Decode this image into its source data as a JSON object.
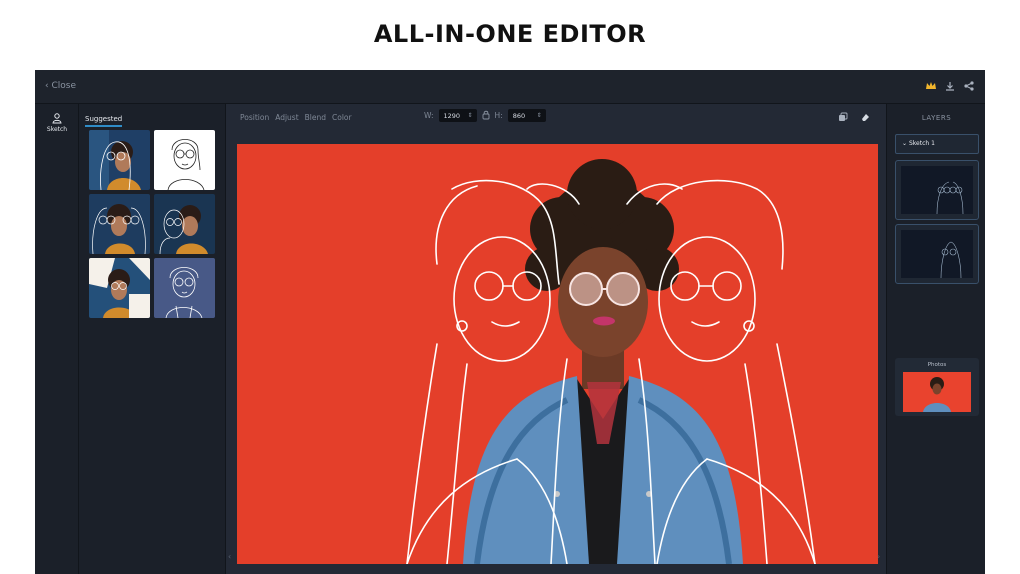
{
  "headline": "ALL-IN-ONE EDITOR",
  "topbar": {
    "close_label": "Close",
    "icons": [
      "crown-icon",
      "download-icon",
      "share-icon"
    ]
  },
  "toolrail": {
    "sketch_label": "Sketch",
    "icon": "person-icon"
  },
  "panel": {
    "tab_label": "Suggested",
    "thumbnails": [
      "sketch-variant-1",
      "sketch-variant-2",
      "sketch-variant-3",
      "sketch-variant-4",
      "sketch-variant-5",
      "sketch-variant-6"
    ]
  },
  "workspace": {
    "tabs": [
      "Position",
      "Adjust",
      "Blend",
      "Color"
    ],
    "width_label": "W:",
    "width_value": "1290",
    "height_label": "H:",
    "height_value": "860",
    "icons": [
      "duplicate-icon",
      "eraser-icon"
    ]
  },
  "layers": {
    "title": "LAYERS",
    "group_label": "Sketch 1",
    "photos_label": "Photos"
  },
  "colors": {
    "accent": "#2f8cc7",
    "canvas_bg": "#e9432e",
    "app_bg": "#1b2029"
  }
}
